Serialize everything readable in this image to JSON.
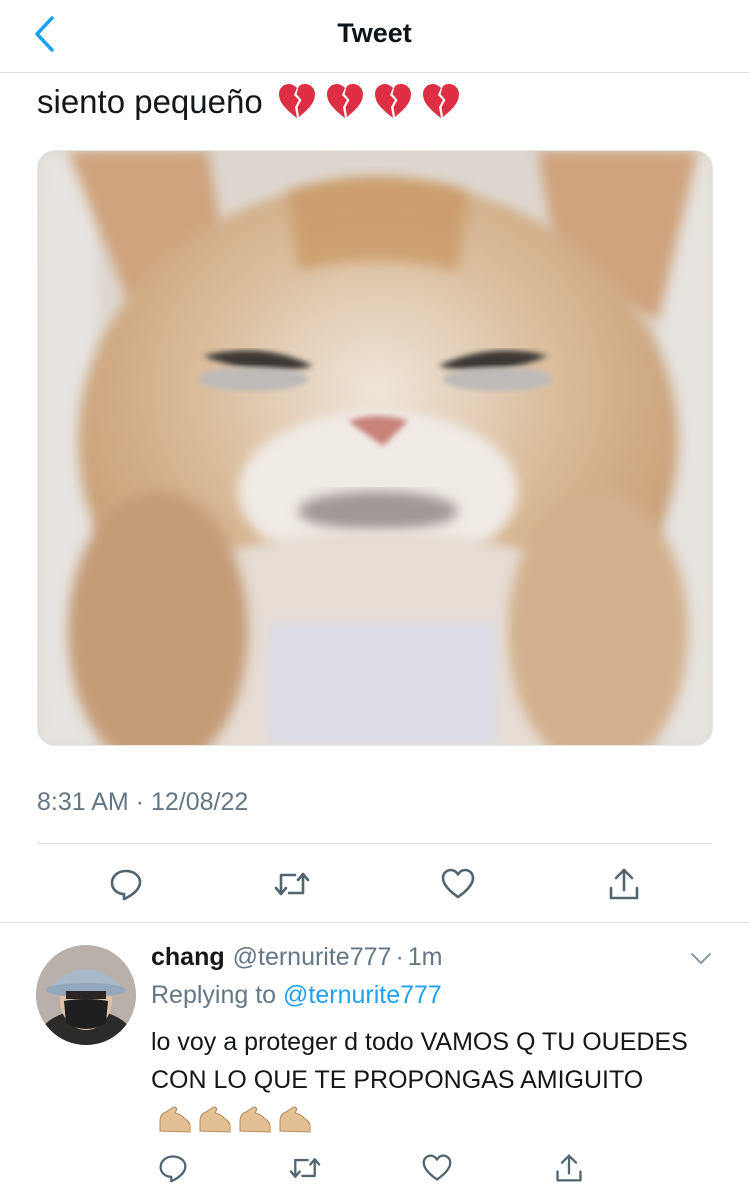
{
  "header": {
    "title": "Tweet",
    "back_icon": "chevron-left-icon"
  },
  "tweet": {
    "text": "siento pequeño",
    "emojis": [
      "broken-heart",
      "broken-heart",
      "broken-heart",
      "broken-heart"
    ],
    "media_alt": "cat-photo",
    "timestamp": "8:31 AM · 12/08/22",
    "actions": [
      "reply-icon",
      "retweet-icon",
      "like-icon",
      "share-icon"
    ]
  },
  "reply": {
    "name": "chang",
    "handle": "@ternurite777",
    "dot": "·",
    "time": "1m",
    "replying_prefix": "Replying to ",
    "replying_to": "@ternurite777",
    "text": "lo voy a proteger d todo VAMOS Q TU OUEDES CON LO QUE TE PROPONGAS AMIGUITO",
    "emojis": [
      "flexed-biceps",
      "flexed-biceps",
      "flexed-biceps",
      "flexed-biceps"
    ],
    "actions": [
      "reply-icon",
      "retweet-icon",
      "like-icon",
      "share-icon"
    ]
  },
  "colors": {
    "accent": "#1da1f2",
    "text": "#14171a",
    "secondary": "#657786",
    "divider": "#dcdee0"
  }
}
